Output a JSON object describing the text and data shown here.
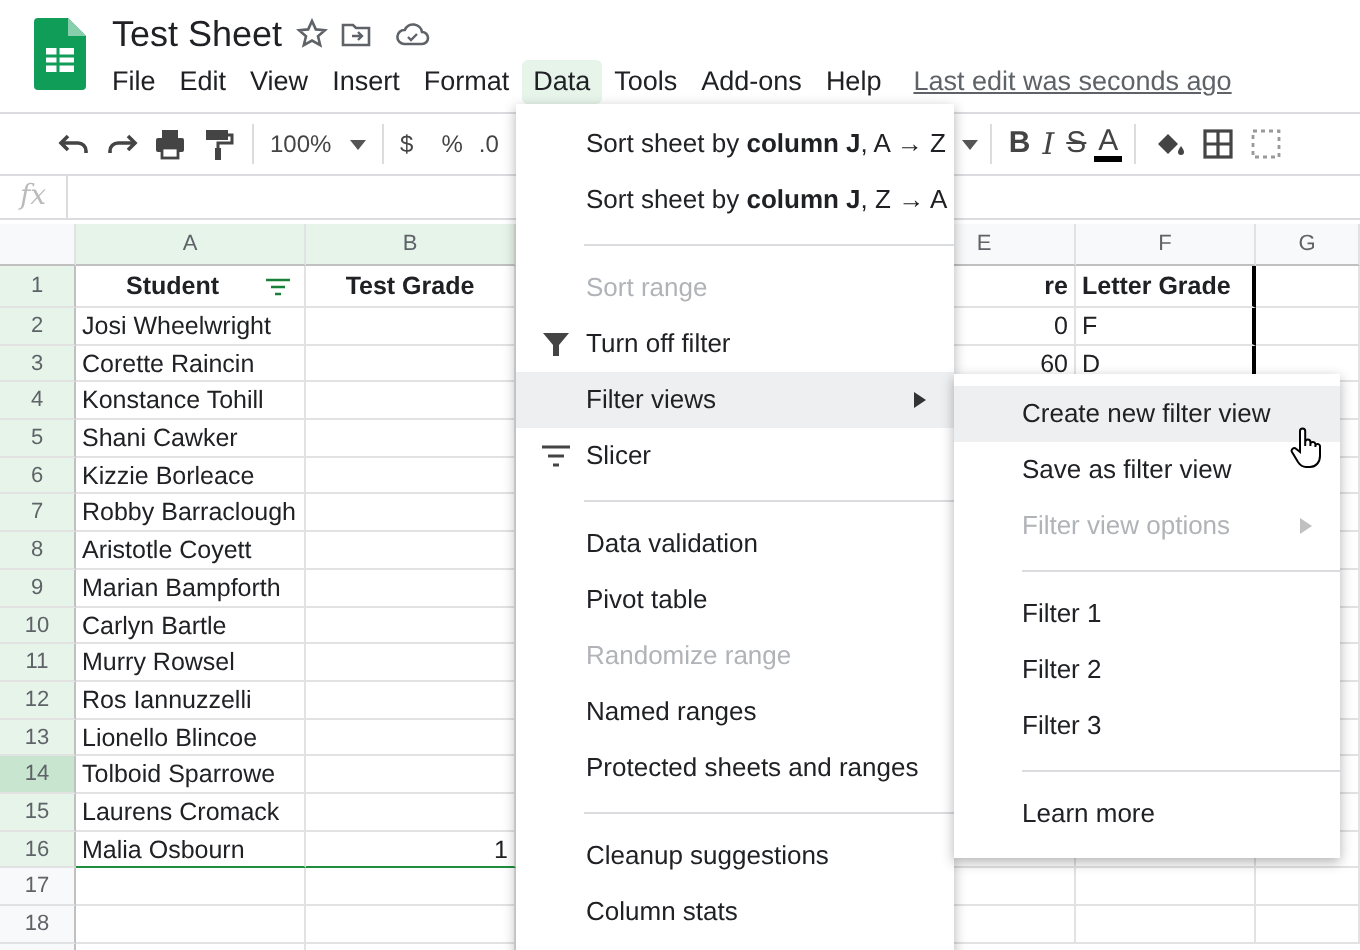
{
  "document": {
    "title": "Test Sheet"
  },
  "menu_bar": [
    {
      "label": "File",
      "selected": false
    },
    {
      "label": "Edit",
      "selected": false
    },
    {
      "label": "View",
      "selected": false
    },
    {
      "label": "Insert",
      "selected": false
    },
    {
      "label": "Format",
      "selected": false
    },
    {
      "label": "Data",
      "selected": true
    },
    {
      "label": "Tools",
      "selected": false
    },
    {
      "label": "Add-ons",
      "selected": false
    },
    {
      "label": "Help",
      "selected": false
    }
  ],
  "last_edit": "Last edit was seconds ago",
  "toolbar": {
    "zoom": "100%",
    "currency": "$",
    "percent": "%",
    "decimal": ".0",
    "bold": "B",
    "italic": "I",
    "strike": "S",
    "text_color": "A"
  },
  "formula_bar": {
    "label": "fx"
  },
  "columns": [
    {
      "label": "A",
      "highlighted": true
    },
    {
      "label": "B",
      "highlighted": true
    },
    {
      "label": "E",
      "highlighted": false
    },
    {
      "label": "F",
      "highlighted": false
    },
    {
      "label": "G",
      "highlighted": false
    }
  ],
  "rows": [
    {
      "number": "1",
      "highlighted": true,
      "selected": false,
      "kind": "header",
      "student": "Student",
      "filter": true,
      "test_grade": "Test Grade",
      "column_e": "re",
      "column_f": "Letter Grade"
    },
    {
      "number": "2",
      "highlighted": true,
      "selected": false,
      "student": "Josi Wheelwright",
      "column_e": "0",
      "column_f": "F"
    },
    {
      "number": "3",
      "highlighted": true,
      "selected": false,
      "student": "Corette Raincin",
      "column_e": "60",
      "column_f": "D"
    },
    {
      "number": "4",
      "highlighted": true,
      "selected": false,
      "student": "Konstance Tohill"
    },
    {
      "number": "5",
      "highlighted": true,
      "selected": false,
      "student": "Shani Cawker"
    },
    {
      "number": "6",
      "highlighted": true,
      "selected": false,
      "student": "Kizzie Borleace"
    },
    {
      "number": "7",
      "highlighted": true,
      "selected": false,
      "student": "Robby Barraclough"
    },
    {
      "number": "8",
      "highlighted": true,
      "selected": false,
      "student": "Aristotle Coyett"
    },
    {
      "number": "9",
      "highlighted": true,
      "selected": false,
      "student": "Marian Bampforth"
    },
    {
      "number": "10",
      "highlighted": true,
      "selected": false,
      "student": "Carlyn Bartle"
    },
    {
      "number": "11",
      "highlighted": true,
      "selected": false,
      "student": "Murry Rowsel"
    },
    {
      "number": "12",
      "highlighted": true,
      "selected": false,
      "student": "Ros Iannuzzelli"
    },
    {
      "number": "13",
      "highlighted": true,
      "selected": false,
      "student": "Lionello Blincoe"
    },
    {
      "number": "14",
      "highlighted": true,
      "selected": true,
      "student": "Tolboid Sparrowe"
    },
    {
      "number": "15",
      "highlighted": true,
      "selected": false,
      "student": "Laurens Cromack"
    },
    {
      "number": "16",
      "highlighted": true,
      "selected": false,
      "student": "Malia Osbourn",
      "test_grade": "1"
    },
    {
      "number": "17",
      "highlighted": false,
      "selected": false
    },
    {
      "number": "18",
      "highlighted": false,
      "selected": false
    }
  ],
  "data_menu": [
    {
      "kind": "item",
      "label": "Sort sheet by **column J**, A → Z",
      "disabled": false,
      "highlighted": false
    },
    {
      "kind": "item",
      "label": "Sort sheet by **column J**, Z → A",
      "disabled": false,
      "highlighted": false
    },
    {
      "kind": "divider"
    },
    {
      "kind": "item",
      "label": "Sort range",
      "disabled": true,
      "highlighted": false
    },
    {
      "kind": "filter_item",
      "label": "Turn off filter",
      "disabled": false,
      "highlighted": false
    },
    {
      "kind": "submenu",
      "label": "Filter views",
      "disabled": false,
      "highlighted": true
    },
    {
      "kind": "slicer_item",
      "label": "Slicer",
      "disabled": false,
      "highlighted": false
    },
    {
      "kind": "divider"
    },
    {
      "kind": "item",
      "label": "Data validation",
      "disabled": false,
      "highlighted": false
    },
    {
      "kind": "item",
      "label": "Pivot table",
      "disabled": false,
      "highlighted": false
    },
    {
      "kind": "item",
      "label": "Randomize range",
      "disabled": true,
      "highlighted": false
    },
    {
      "kind": "item",
      "label": "Named ranges",
      "disabled": false,
      "highlighted": false
    },
    {
      "kind": "item",
      "label": "Protected sheets and ranges",
      "disabled": false,
      "highlighted": false
    },
    {
      "kind": "divider"
    },
    {
      "kind": "item",
      "label": "Cleanup suggestions",
      "disabled": false,
      "highlighted": false
    },
    {
      "kind": "item",
      "label": "Column stats",
      "disabled": false,
      "highlighted": false
    }
  ],
  "filter_views_submenu": [
    {
      "kind": "item",
      "label": "Create new filter view",
      "disabled": false,
      "highlighted": true
    },
    {
      "kind": "item",
      "label": "Save as filter view",
      "disabled": false,
      "highlighted": false
    },
    {
      "kind": "submenu",
      "label": "Filter view options",
      "disabled": true,
      "highlighted": false
    },
    {
      "kind": "divider"
    },
    {
      "kind": "item",
      "label": "Filter 1",
      "disabled": false,
      "highlighted": false
    },
    {
      "kind": "item",
      "label": "Filter 2",
      "disabled": false,
      "highlighted": false
    },
    {
      "kind": "item",
      "label": "Filter 3",
      "disabled": false,
      "highlighted": false
    },
    {
      "kind": "divider"
    },
    {
      "kind": "item",
      "label": "Learn more",
      "disabled": false,
      "highlighted": false
    }
  ]
}
